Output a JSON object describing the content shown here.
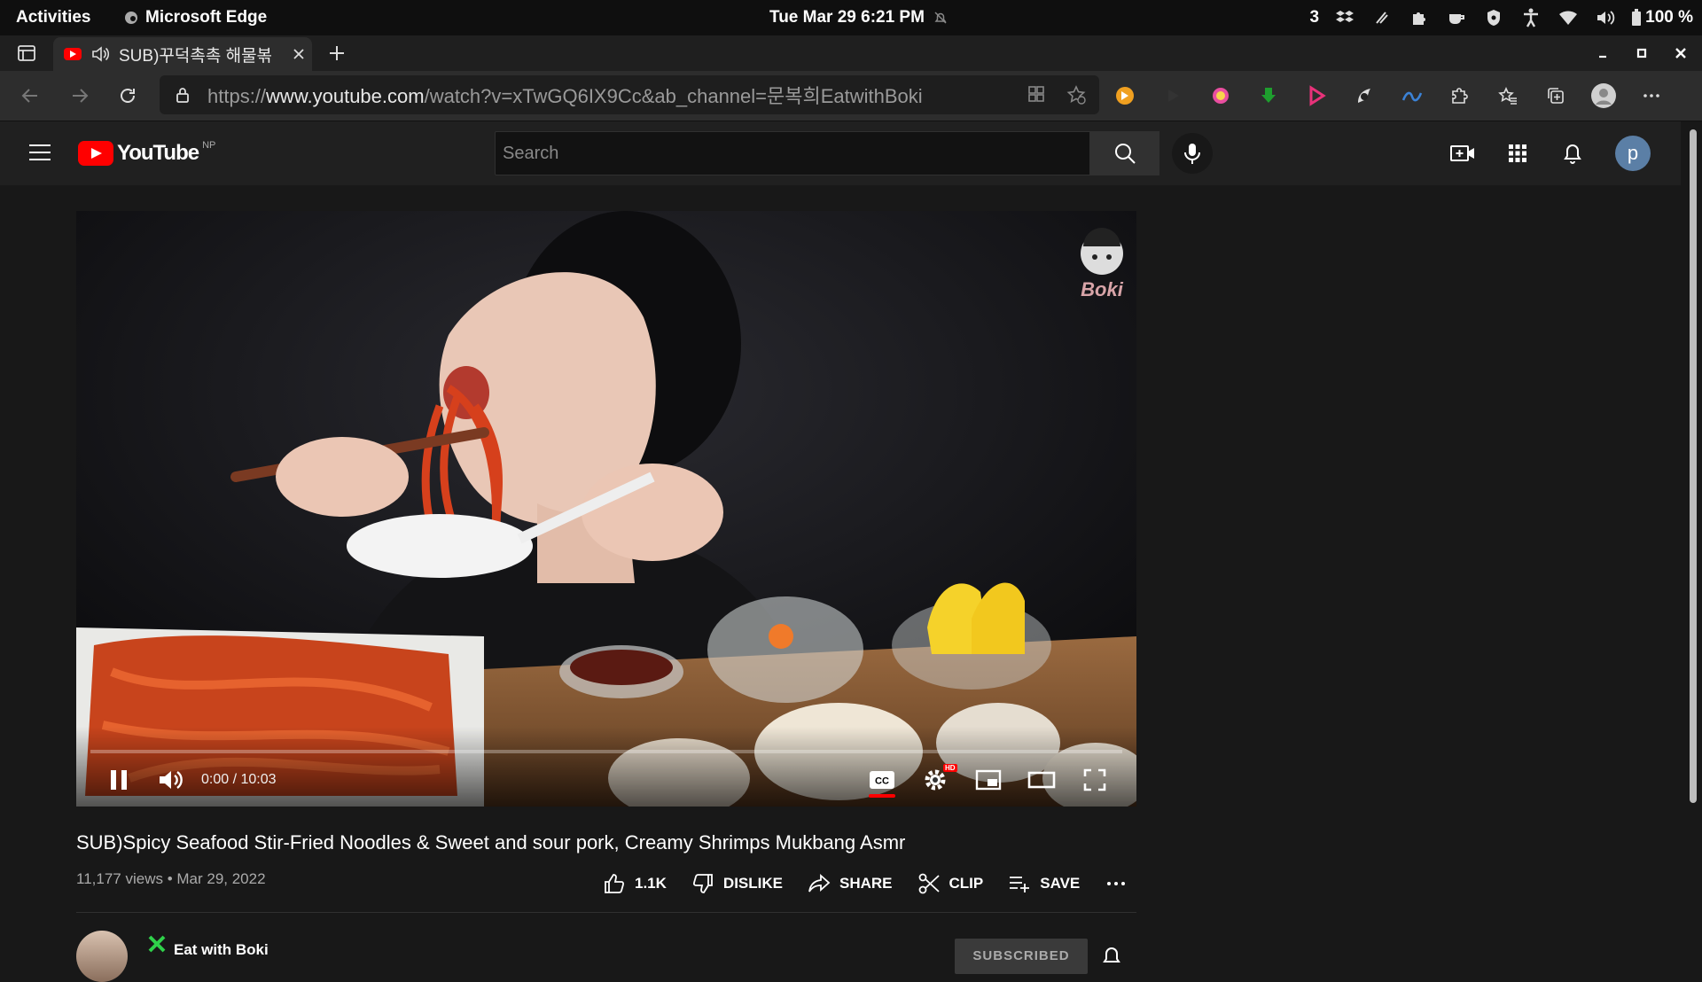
{
  "os": {
    "activities": "Activities",
    "app_name": "Microsoft Edge",
    "datetime": "Tue Mar 29  6:21 PM",
    "notification_count": "3",
    "battery": "100 %"
  },
  "browser": {
    "tab_title": "SUB)꾸덕촉촉 해물볶",
    "url_prefix": "https://",
    "url_host": "www.youtube.com",
    "url_path": "/watch?v=xTwGQ6IX9Cc&ab_channel=문복희EatwithBoki"
  },
  "youtube": {
    "logo_text": "YouTube",
    "region": "NP",
    "search_placeholder": "Search",
    "avatar_letter": "p"
  },
  "player": {
    "time": "0:00 / 10:03",
    "watermark": "Boki",
    "progress_fraction": 0.0
  },
  "video": {
    "title": "SUB)Spicy Seafood Stir-Fried Noodles & Sweet and sour pork, Creamy Shrimps Mukbang Asmr",
    "stats": "11,177 views • Mar 29, 2022",
    "like_count": "1.1K",
    "dislike_label": "DISLIKE",
    "share_label": "SHARE",
    "clip_label": "CLIP",
    "save_label": "SAVE"
  },
  "channel": {
    "name": "Eat with Boki",
    "subscribe_label": "SUBSCRIBED"
  }
}
